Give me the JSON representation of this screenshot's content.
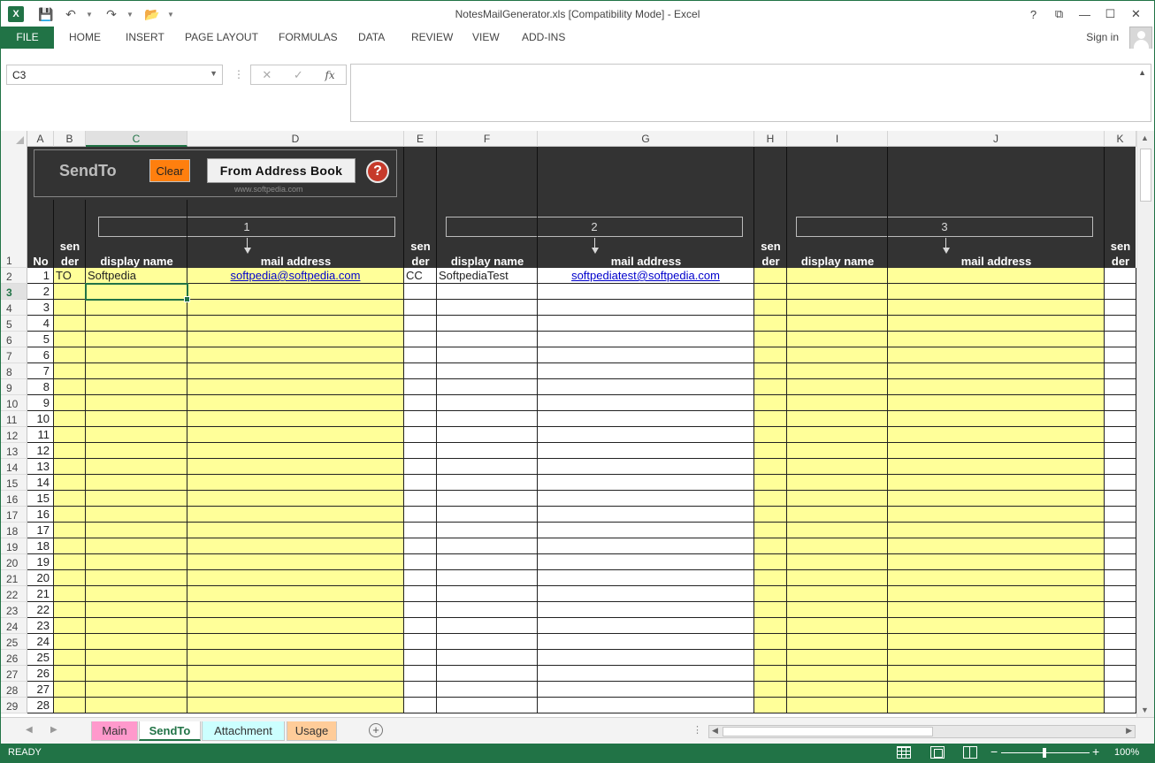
{
  "window": {
    "title": "NotesMailGenerator.xls  [Compatibility Mode] - Excel",
    "ctrls": [
      "?",
      "⧉",
      "—",
      "☐",
      "✕"
    ]
  },
  "ribbon": {
    "file": "FILE",
    "tabs": [
      "HOME",
      "INSERT",
      "PAGE LAYOUT",
      "FORMULAS",
      "DATA",
      "REVIEW",
      "VIEW",
      "ADD-INS"
    ],
    "signin": "Sign in"
  },
  "formula_bar": {
    "name_box": "C3",
    "fx": "fx",
    "value": ""
  },
  "columns": [
    "A",
    "B",
    "C",
    "D",
    "E",
    "F",
    "G",
    "H",
    "I",
    "J",
    "K"
  ],
  "row_numbers": [
    "1",
    "2",
    "3",
    "4",
    "5",
    "6",
    "7",
    "8",
    "9",
    "10",
    "11",
    "12",
    "13",
    "14",
    "15",
    "16",
    "17",
    "18",
    "19",
    "20",
    "21",
    "22",
    "23",
    "24",
    "25",
    "26",
    "27",
    "28",
    "29"
  ],
  "header": {
    "panel_title": "SendTo",
    "clear_label": "Clear",
    "address_book_label": "From Address Book",
    "watermark": "www.softpedia.com",
    "help_glyph": "?",
    "groups": [
      "1",
      "2",
      "3"
    ],
    "no_label": "No",
    "sender_label_1": "sen",
    "sender_label_2": "der",
    "display_name_label": "display name",
    "mail_address_label": "mail address"
  },
  "rows": [
    {
      "no": "1",
      "s1": "TO",
      "n1": "Softpedia",
      "m1": "softpedia@softpedia.com",
      "s2": "CC",
      "n2": "SoftpediaTest",
      "m2": "softpediatest@softpedia.com",
      "s3": "",
      "n3": "",
      "m3": "",
      "s4": ""
    },
    {
      "no": "2"
    },
    {
      "no": "3"
    },
    {
      "no": "4"
    },
    {
      "no": "5"
    },
    {
      "no": "6"
    },
    {
      "no": "7"
    },
    {
      "no": "8"
    },
    {
      "no": "9"
    },
    {
      "no": "10"
    },
    {
      "no": "11"
    },
    {
      "no": "12"
    },
    {
      "no": "13"
    },
    {
      "no": "14"
    },
    {
      "no": "15"
    },
    {
      "no": "16"
    },
    {
      "no": "17"
    },
    {
      "no": "18"
    },
    {
      "no": "19"
    },
    {
      "no": "20"
    },
    {
      "no": "21"
    },
    {
      "no": "22"
    },
    {
      "no": "23"
    },
    {
      "no": "24"
    },
    {
      "no": "25"
    },
    {
      "no": "26"
    },
    {
      "no": "27"
    },
    {
      "no": "28"
    }
  ],
  "sheets": [
    {
      "name": "Main",
      "color": "#ff99cc",
      "active": false
    },
    {
      "name": "SendTo",
      "color": "#ffffff",
      "active": true
    },
    {
      "name": "Attachment",
      "color": "#ccffff",
      "active": false
    },
    {
      "name": "Usage",
      "color": "#ffcc99",
      "active": false
    }
  ],
  "status": {
    "text": "READY",
    "zoom": "100%"
  },
  "colors": {
    "accent": "#217346",
    "input_fill": "#ffff99",
    "header_fill": "#333333",
    "clear_button": "#ff7f0e"
  }
}
